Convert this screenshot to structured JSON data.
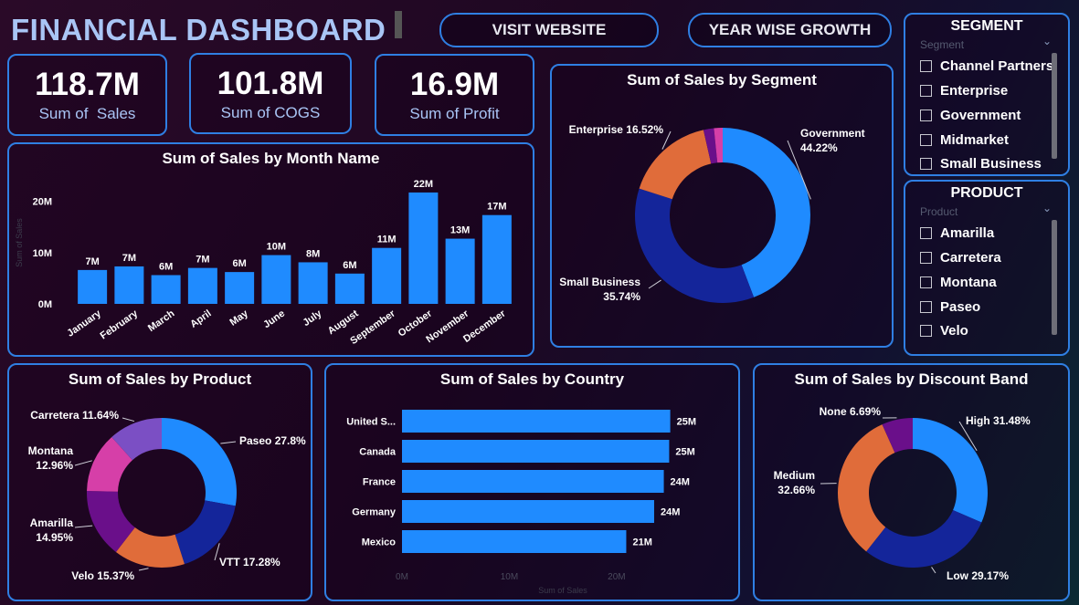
{
  "header": {
    "title": "FINANCIAL DASHBOARD",
    "visit_label": "VISIT WEBSITE",
    "growth_label": "YEAR WISE GROWTH"
  },
  "kpis": [
    {
      "value": "118.7M",
      "label": "Sum of  Sales"
    },
    {
      "value": "101.8M",
      "label": "Sum of COGS"
    },
    {
      "value": "16.9M",
      "label": "Sum of Profit"
    }
  ],
  "colors": {
    "blue": "#1f8bff",
    "navy": "#14259a",
    "orange": "#e06c3a",
    "purple": "#6a0f8a",
    "magenta": "#d63fa8",
    "violet": "#7b4fc4",
    "border": "#2f7fe3"
  },
  "slicers": {
    "segment": {
      "title": "SEGMENT",
      "header": "Segment",
      "items": [
        "Channel Partners",
        "Enterprise",
        "Government",
        "Midmarket",
        "Small Business"
      ]
    },
    "product": {
      "title": "PRODUCT",
      "header": "Product",
      "items": [
        "Amarilla",
        "Carretera",
        "Montana",
        "Paseo",
        "Velo"
      ]
    }
  },
  "chart_data": [
    {
      "id": "month",
      "type": "bar",
      "title": "Sum of Sales by Month Name",
      "ylabel": "Sum of Sales",
      "categories": [
        "January",
        "February",
        "March",
        "April",
        "May",
        "June",
        "July",
        "August",
        "September",
        "October",
        "November",
        "December"
      ],
      "values": [
        6.6,
        7.3,
        5.6,
        7.0,
        6.2,
        9.5,
        8.1,
        5.9,
        10.9,
        21.7,
        12.7,
        17.3
      ],
      "labels": [
        "7M",
        "7M",
        "6M",
        "7M",
        "6M",
        "10M",
        "8M",
        "6M",
        "11M",
        "22M",
        "13M",
        "17M"
      ],
      "yticks": [
        "0M",
        "10M",
        "20M"
      ],
      "ylim": [
        0,
        24
      ]
    },
    {
      "id": "segment",
      "type": "pie",
      "title": "Sum of Sales by Segment",
      "slices": [
        {
          "name": "Government",
          "value": 44.22,
          "label": "Government 44.22%",
          "color": "#1f8bff"
        },
        {
          "name": "Small Business",
          "value": 35.74,
          "label": "Small Business 35.74%",
          "color": "#14259a"
        },
        {
          "name": "Enterprise",
          "value": 16.52,
          "label": "Enterprise 16.52%",
          "color": "#e06c3a"
        },
        {
          "name": "Midmarket",
          "value": 1.92,
          "label": "",
          "color": "#6a0f8a"
        },
        {
          "name": "Channel Partners",
          "value": 1.6,
          "label": "",
          "color": "#d63fa8"
        }
      ]
    },
    {
      "id": "product",
      "type": "pie",
      "title": "Sum of Sales by Product",
      "slices": [
        {
          "name": "Paseo",
          "value": 27.8,
          "label": "Paseo 27.8%",
          "color": "#1f8bff"
        },
        {
          "name": "VTT",
          "value": 17.28,
          "label": "VTT 17.28%",
          "color": "#14259a"
        },
        {
          "name": "Velo",
          "value": 15.37,
          "label": "Velo 15.37%",
          "color": "#e06c3a"
        },
        {
          "name": "Amarilla",
          "value": 14.95,
          "label": "Amarilla 14.95%",
          "color": "#6a0f8a"
        },
        {
          "name": "Montana",
          "value": 12.96,
          "label": "Montana 12.96%",
          "color": "#d63fa8"
        },
        {
          "name": "Carretera",
          "value": 11.64,
          "label": "Carretera 11.64%",
          "color": "#7b4fc4"
        }
      ]
    },
    {
      "id": "country",
      "type": "bar",
      "orientation": "horizontal",
      "title": "Sum of Sales by Country",
      "xlabel": "Sum of Sales",
      "categories": [
        "United S...",
        "Canada",
        "France",
        "Germany",
        "Mexico"
      ],
      "values": [
        25.0,
        24.9,
        24.4,
        23.5,
        20.9
      ],
      "labels": [
        "25M",
        "25M",
        "24M",
        "24M",
        "21M"
      ],
      "xticks": [
        "0M",
        "10M",
        "20M"
      ],
      "xlim": [
        0,
        25.8
      ]
    },
    {
      "id": "discount",
      "type": "pie",
      "title": "Sum of Sales by Discount Band",
      "slices": [
        {
          "name": "High",
          "value": 31.48,
          "label": "High 31.48%",
          "color": "#1f8bff"
        },
        {
          "name": "Low",
          "value": 29.17,
          "label": "Low 29.17%",
          "color": "#14259a"
        },
        {
          "name": "Medium",
          "value": 32.66,
          "label": "Medium 32.66%",
          "color": "#e06c3a"
        },
        {
          "name": "None",
          "value": 6.69,
          "label": "None 6.69%",
          "color": "#6a0f8a"
        }
      ]
    }
  ]
}
